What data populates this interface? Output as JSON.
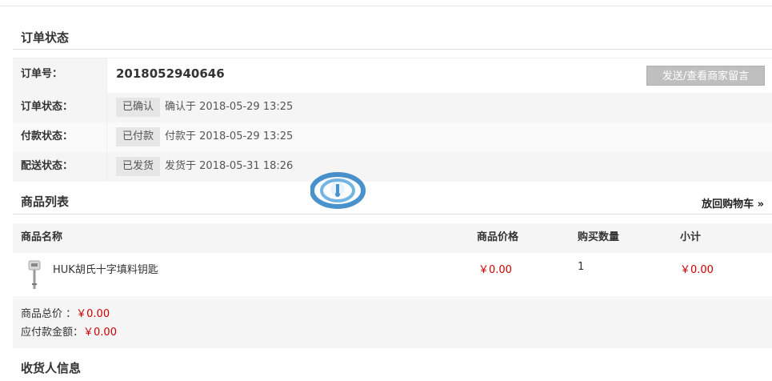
{
  "order_status_section": {
    "title": "订单状态"
  },
  "order": {
    "number_label": "订单号：",
    "number": "2018052940646",
    "message_button": "发送/查看商家留言",
    "rows": [
      {
        "label": "订单状态：",
        "badge": "已确认",
        "text": "确认于 2018-05-29 13:25"
      },
      {
        "label": "付款状态：",
        "badge": "已付款",
        "text": "付款于 2018-05-29 13:25"
      },
      {
        "label": "配送状态：",
        "badge": "已发货",
        "text": "发货于 2018-05-31 18:26"
      }
    ]
  },
  "goods_section": {
    "title": "商品列表",
    "back_link": "放回购物车 »",
    "columns": [
      "商品名称",
      "商品价格",
      "购买数量",
      "小计"
    ],
    "items": [
      {
        "name": "HUK胡氏十字填料钥匙",
        "price": "￥0.00",
        "qty": "1",
        "subtotal": "￥0.00",
        "thumb_icon": "key-product-icon"
      }
    ],
    "total_label": "商品总价 ：",
    "total_value": "￥0.00",
    "payable_label": "应付款金额：",
    "payable_value": "￥0.00"
  },
  "consignee_section": {
    "title": "收货人信息"
  },
  "colors": {
    "price": "#cc0000",
    "label_bg": "#f5f5f5",
    "button_bg": "#bfbfbf"
  }
}
